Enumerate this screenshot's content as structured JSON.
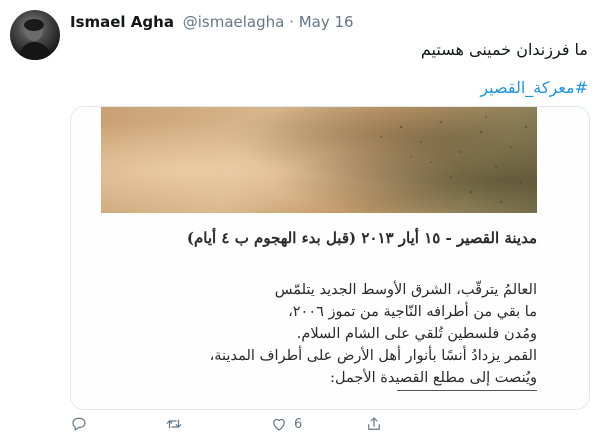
{
  "tweet": {
    "display_name": "Ismael Agha",
    "handle": "@ismaelagha",
    "separator": "·",
    "date": "May 16",
    "text": "ما فرزندان خمینی هستیم",
    "hashtag": "#معركة_القصير"
  },
  "media": {
    "heading_line1": "مدينة القصير - ١٥ أيار ٢٠١٣",
    "heading_line2": "(قبل بدء الهجوم ب ٤ أيام)",
    "poem_lines": [
      "العالمُ يترقّب، الشرق الأوسط الجديد يتلمّس",
      "ما بقي من أطرافه النّاجية من تموز ٢٠٠٦،",
      "ومُدن فلسطين تُلقي على الشام السلام.",
      "القمر يزدادُ أنسًا بأنوار أهل الأرض على أطراف المدينة،",
      "ويُنصت إلى مطلع القصيدة الأجمل:"
    ]
  },
  "actions": {
    "reply_icon": "comment-icon",
    "retweet_icon": "retweet-icon",
    "like_icon": "heart-icon",
    "like_count": "6",
    "share_icon": "share-icon",
    "color": "#657786"
  },
  "colors": {
    "link": "#1b95e0",
    "text": "#14171a",
    "muted": "#657786"
  }
}
